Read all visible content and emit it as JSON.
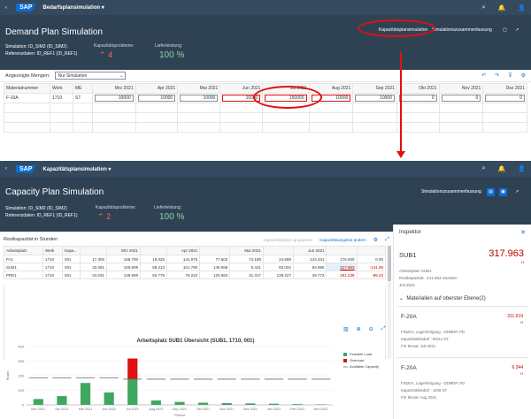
{
  "demand": {
    "shell": {
      "back": "‹",
      "logo": "SAP",
      "title": "Bedarfsplansimulation ▾",
      "icons": [
        "⌕",
        "🔔",
        "👤"
      ]
    },
    "header": {
      "title": "Demand Plan Simulation",
      "simulation": "Simulation:  ID_SIM2 (ID_SIM2)",
      "reference": "Referenzdaten:  ID_REF1 (ID_REF1)",
      "kpi_problems_label": "Kapazitätsprobleme:",
      "kpi_problems_value": "4",
      "kpi_delivery_label": "Lieferleistung:",
      "kpi_delivery_value": "100 %",
      "action_capacity": "Kapazitätsplansimulation",
      "action_summary": "Simulationszusammenfassung"
    },
    "toolbar": {
      "label": "Angezeigte Mengen:",
      "select_value": "Nur Simulation"
    },
    "table": {
      "columns": [
        "Materialnummer",
        "Werk",
        "ME",
        "Mrz 2021",
        "Apr 2021",
        "Mai 2021",
        "Jun 2021",
        "Jul 2021",
        "Aug 2021",
        "Sep 2021",
        "Okt 2021",
        "Nov 2021",
        "Dez 2021"
      ],
      "rows": [
        {
          "material": "F-20A",
          "werk": "1710",
          "me": "ST",
          "values": [
            "10000",
            "10000",
            "10000",
            "10000",
            "150000",
            "10000",
            "10000",
            "0",
            "0",
            "0"
          ]
        }
      ]
    }
  },
  "capacity": {
    "shell": {
      "back": "‹",
      "logo": "SAP",
      "title": "Kapazitätsplansimulation ▾",
      "icons": [
        "⌕",
        "🔔",
        "👤"
      ]
    },
    "header": {
      "title": "Capacity Plan Simulation",
      "simulation": "Simulation:  ID_SIM2 (ID_SIM2)",
      "reference": "Referenzdaten:  ID_REF1 (ID_REF1)",
      "kpi_problems_label": "Kapazitätsprobleme:",
      "kpi_problems_value": "2",
      "kpi_delivery_label": "Lieferleistung:",
      "kpi_delivery_value": "100 %",
      "action_summary": "Simulationszusammenfassung"
    },
    "table": {
      "title": "Restkapazität in Stunden",
      "link_group": "Kapazitätsplätze gruppieren",
      "link_change": "Kapazitätsangebot ändern",
      "columns": [
        "Arbeitsplatz",
        "Werk",
        "Kapa...",
        "",
        "Mrz 2021",
        "",
        "Apr 2021",
        "",
        "Mai 2021",
        "",
        "Jun 2021",
        "",
        ""
      ],
      "rows": [
        {
          "cells": [
            "FA1",
            "1710",
            "001",
            "17.300",
            "166.700",
            "18.025",
            "141.975",
            "77.602",
            "74.198",
            "24.659",
            "143.341",
            "176.000",
            "0.00"
          ]
        },
        {
          "cells": [
            "SUB1",
            "1710",
            "001",
            "33.391",
            "150.609",
            "58.213",
            "101.790",
            "146.559",
            "5.441",
            "83.034",
            "84.966",
            "317.963",
            "-141.96"
          ]
        },
        {
          "cells": [
            "PRE1",
            "1710",
            "001",
            "34.031",
            "149.969",
            "83.779",
            "76.222",
            "120.683",
            "31.317",
            "139.227",
            "29.773",
            "261.238",
            "-85.23"
          ]
        }
      ]
    },
    "inspector": {
      "title": "Inspektor",
      "close": "✕",
      "name": "SUB1",
      "value": "317.963",
      "unit": "H",
      "line1": "Arbeitsplatz SUB1",
      "line2": "Restkapazität: -141.963 Stunden",
      "line3": "Juli 2021",
      "section": "Materialien auf oberster Ebene(2)",
      "materials": [
        {
          "name": "F-20A",
          "value": "311.619",
          "unit": "H",
          "l1": "FIN20A, Lagerfertigung - DDMRP, PD",
          "l2": "Kapazitätsbedarf : 93114 ST",
          "l3": "Für Monat: Juli 2021"
        },
        {
          "name": "F-20A",
          "value": "6.344",
          "unit": "H",
          "l1": "FIN20A, Lagerfertigung - DDMRP, PD",
          "l2": "Kapazitätsbedarf : 1848 ST",
          "l3": "Für Monat: Aug 2021"
        }
      ]
    },
    "chart_icons": [
      "▥",
      "⊕",
      "⊖",
      "⤢"
    ]
  },
  "chart_data": {
    "type": "bar",
    "title": "Arbeitsplatz SUB1 Übersicht (SUB1, 1710, 001)",
    "xlabel": "Period",
    "ylabel": "Hours",
    "categories": [
      "Mrz 2021",
      "Apr 2021",
      "Mai 2021",
      "Jun 2021",
      "Jul 2021",
      "Aug 2021",
      "Sep 2021",
      "Okt 2021",
      "Nov 2021",
      "Dez 2021",
      "Jan 2022",
      "Feb 2022",
      "Mrz 2022"
    ],
    "ylim": [
      0,
      400
    ],
    "yticks": [
      0,
      100,
      200,
      300,
      400
    ],
    "series": [
      {
        "name": "Feasible Load",
        "color": "#3fa75f",
        "values": [
          40,
          60,
          150,
          85,
          176,
          30,
          20,
          15,
          12,
          10,
          8,
          5,
          3
        ]
      },
      {
        "name": "Overload",
        "color": "#e01010",
        "values": [
          0,
          0,
          0,
          0,
          142,
          0,
          0,
          0,
          0,
          0,
          0,
          0,
          0
        ]
      },
      {
        "name": "Available Capacity",
        "color": "#6a6d70",
        "values": [
          184,
          184,
          184,
          184,
          176,
          176,
          176,
          176,
          176,
          176,
          176,
          176,
          176
        ]
      }
    ],
    "legend_position": "right"
  }
}
